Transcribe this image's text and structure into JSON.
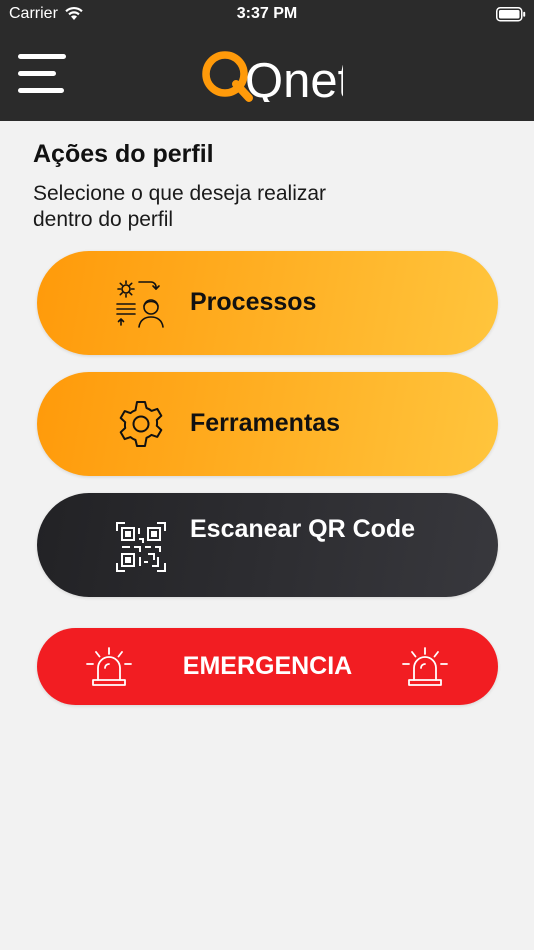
{
  "status_bar": {
    "carrier": "Carrier",
    "time": "3:37 PM",
    "wifi_icon": "wifi-icon",
    "battery_icon": "battery-icon"
  },
  "header": {
    "menu_icon": "menu-icon",
    "logo_text": "Qnet",
    "colors": {
      "background": "#2b2b2b",
      "logo_q": "#ff9a0a",
      "logo_text": "#ffffff"
    }
  },
  "main": {
    "title": "Ações do perfil",
    "subtitle": "Selecione o que deseja realizar dentro do perfil",
    "actions": [
      {
        "label": "Processos",
        "icon": "processes-icon",
        "style": "orange"
      },
      {
        "label": "Ferramentas",
        "icon": "gear-icon",
        "style": "orange"
      },
      {
        "label": "Escanear QR Code",
        "icon": "qr-code-icon",
        "style": "dark"
      }
    ],
    "emergency": {
      "label": "EMERGENCIA",
      "icon": "siren-icon",
      "color": "#f21d22"
    }
  }
}
